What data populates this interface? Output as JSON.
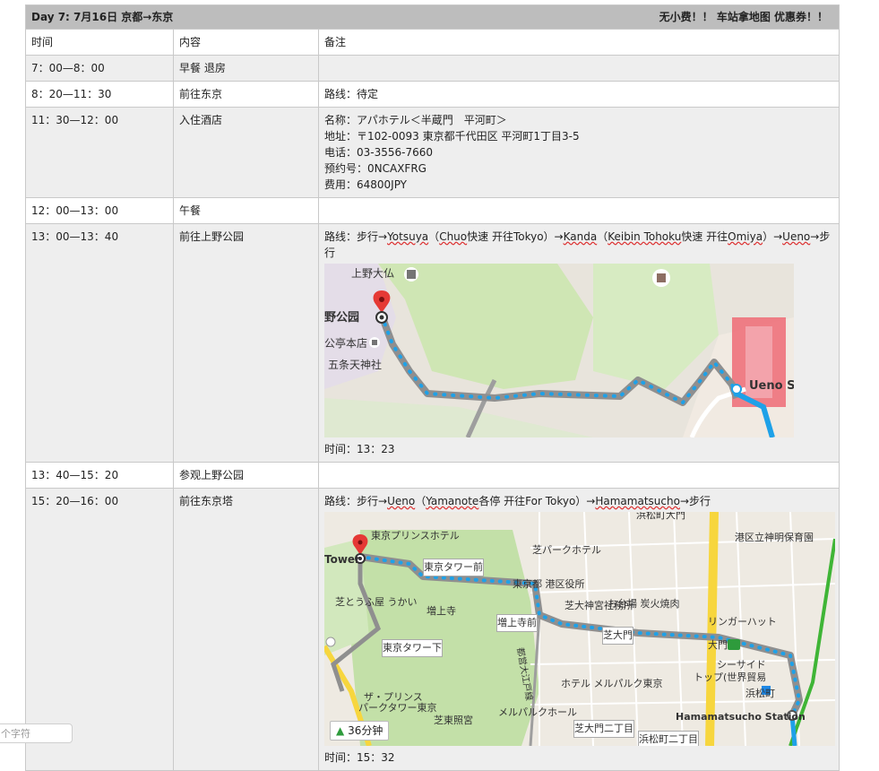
{
  "header": {
    "title": "Day 7: 7月16日 京都→东京",
    "note": "无小费！！ 车站拿地图 优惠券！！"
  },
  "columns": [
    "时间",
    "内容",
    "备注"
  ],
  "rows": [
    {
      "time": "7：00—8：00",
      "content": "早餐 退房",
      "notes": []
    },
    {
      "time": "8：20—11：30",
      "content": "前往东京",
      "notes": [
        "路线：待定"
      ]
    },
    {
      "time": "11：30—12：00",
      "content": "入住酒店",
      "notes": [
        "名称：アパホテル＜半蔵門　平河町＞",
        "地址：〒102-0093 東京都千代田区 平河町1丁目3-5",
        "电话：03-3556-7660",
        "预约号：0NCAXFRG",
        "费用：64800JPY"
      ]
    },
    {
      "time": "12：00—13：00",
      "content": "午餐",
      "notes": []
    },
    {
      "time": "13：00—13：40",
      "content": "前往上野公园",
      "route": {
        "prefix": "路线：步行→",
        "seg1": "Yotsuya",
        "mid1": "（",
        "seg2": "Chuo",
        "mid2": "快速 开往Tokyo）→",
        "seg3": "Kanda",
        "mid3": "（",
        "seg4": "Keibin Tohoku",
        "mid4": "快速 开往",
        "seg5": "Omiya",
        "mid5": "）→",
        "seg6": "Ueno",
        "suffix": "→步行"
      },
      "map": {
        "labels": [
          "上野大仏",
          "野公园",
          "公亭本店",
          "五条天神社",
          "Ueno S"
        ]
      },
      "duration": "时间：13：23"
    },
    {
      "time": "13：40—15：20",
      "content": "参观上野公园",
      "notes": []
    },
    {
      "time": "15：20—16：00",
      "content": "前往东京塔",
      "route": {
        "prefix": "路线：步行→",
        "seg1": "Ueno",
        "mid1": "（",
        "seg2": "Yamanote",
        "mid2": "各停 开往For Tokyo）→",
        "seg3": "Hamamatsucho",
        "suffix": "→步行"
      },
      "map": {
        "labels": [
          "浜松町大門",
          "東京プリンスホテル",
          "港区立神明保育園",
          "Tower",
          "芝パークホテル",
          "東京タワー前",
          "東京都 港区役所",
          "お台場 炭火焼肉",
          "芝とうふ屋 うかい",
          "増上寺",
          "芝大神宮社務所",
          "増上寺前",
          "リンガーハット",
          "東京タワー下",
          "芝大門",
          "大門",
          "シーサイド",
          "トップ(世界貿易",
          "浜松町",
          "ザ・プリンス",
          "パークタワー東京",
          "ホテル メルパルク東京",
          "メルパルクホール",
          "芝東照宮",
          "芝大門二丁目",
          "浜松町二丁目",
          "Hamamatsucho Station",
          "都営大江戸線"
        ],
        "badge": "36分钟"
      },
      "duration": "时间：15：32"
    }
  ],
  "charcount": "个字符",
  "colors": {
    "header_bg": "#bdbdbd",
    "row_gray": "#eeeeee",
    "route_blue": "#1e88e5",
    "pin_red": "#e53935"
  }
}
